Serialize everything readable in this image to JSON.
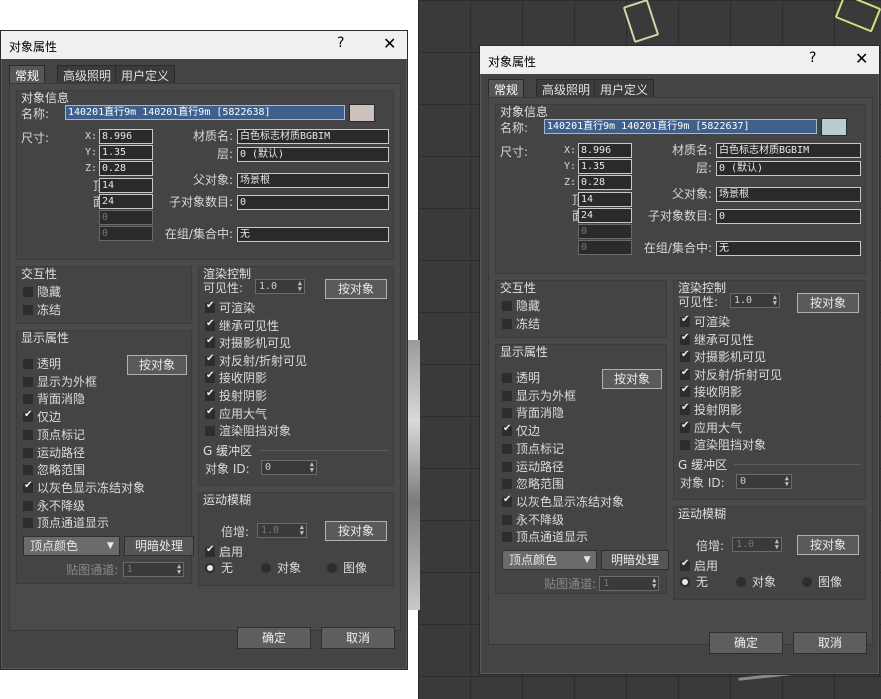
{
  "background": {
    "viewport_color": "#3a3a3a"
  },
  "common": {
    "title": "对象属性",
    "help_label": "?",
    "close_label": "✕",
    "tabs": [
      "常规",
      "高级照明",
      "用户定义"
    ],
    "object_info": {
      "group_label": "对象信息",
      "name_label": "名称:",
      "size_label": "尺寸:",
      "x_label": "X:",
      "y_label": "Y:",
      "z_label": "Z:",
      "x": "8.996",
      "y": "1.35",
      "z": "0.28",
      "vertices_label": "顶点:",
      "vertices": "14",
      "faces_label": "面数:",
      "faces": "24",
      "blank1": "0",
      "blank2": "0",
      "material_label": "材质名:",
      "material": "白色标志材质BGBIM",
      "layer_label": "层:",
      "layer": "0 (默认)",
      "parent_label": "父对象:",
      "parent": "场景根",
      "children_label": "子对象数目:",
      "children": "0",
      "ingroup_label": "在组/集合中:",
      "ingroup": "无"
    },
    "interaction": {
      "group_label": "交互性",
      "hide": "隐藏",
      "freeze": "冻结"
    },
    "display": {
      "group_label": "显示属性",
      "by_object": "按对象",
      "items": [
        "透明",
        "显示为外框",
        "背面消隐",
        "仅边",
        "顶点标记",
        "运动路径",
        "忽略范围",
        "以灰色显示冻结对象",
        "永不降级",
        "顶点通道显示"
      ],
      "checked": [
        false,
        false,
        false,
        true,
        false,
        false,
        false,
        true,
        false,
        false
      ],
      "vertex_color": "顶点颜色",
      "shading": "明暗处理",
      "map_channel_label": "贴图通道:",
      "map_channel": "1"
    },
    "render": {
      "group_label": "渲染控制",
      "visibility_label": "可见性:",
      "visibility": "1.0",
      "by_object": "按对象",
      "items": [
        "可渲染",
        "继承可见性",
        "对摄影机可见",
        "对反射/折射可见",
        "接收阴影",
        "投射阴影",
        "应用大气",
        "渲染阻挡对象"
      ],
      "checked": [
        true,
        true,
        true,
        true,
        true,
        true,
        true,
        false
      ],
      "gbuffer_label": "G 缓冲区",
      "object_id_label": "对象 ID:",
      "object_id": "0"
    },
    "motion_blur": {
      "group_label": "运动模糊",
      "multiplier_label": "倍增:",
      "multiplier": "1.0",
      "by_object": "按对象",
      "enabled": "启用",
      "none": "无",
      "object": "对象",
      "image": "图像"
    },
    "ok": "确定",
    "cancel": "取消"
  },
  "dialog_left": {
    "name_value": "140201直行9m 140201直行9m [5822638]",
    "color": "#cfc0c0"
  },
  "dialog_right": {
    "name_value": "140201直行9m 140201直行9m [5822637]",
    "color": "#b8ccd2"
  }
}
